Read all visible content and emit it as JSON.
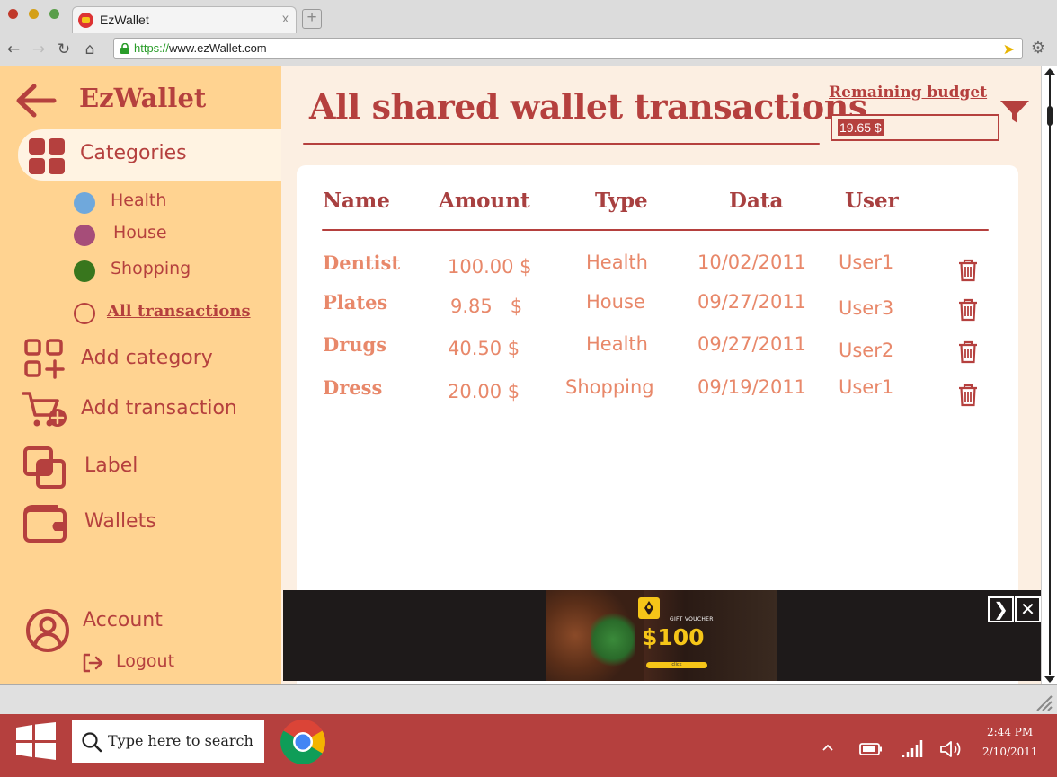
{
  "browser": {
    "tab_title": "EzWallet",
    "tab_close": "x",
    "url_protocol": "https://",
    "url_rest": "www.ezWallet.com"
  },
  "sidebar": {
    "brand": "EzWallet",
    "categories_label": "Categories",
    "category_items": [
      {
        "label": "Health",
        "color": "#6fa8dc"
      },
      {
        "label": "House",
        "color": "#a64d79"
      },
      {
        "label": "Shopping",
        "color": "#38761d"
      }
    ],
    "all_transactions_label": "All transactions",
    "add_category_label": "Add category",
    "add_transaction_label": "Add transaction",
    "label_label": "Label",
    "wallets_label": "Wallets",
    "account_label": "Account",
    "logout_label": "Logout"
  },
  "main": {
    "title": "All shared wallet transactions",
    "budget_label": "Remaining budget",
    "budget_value": "19.65 $",
    "columns": [
      "Name",
      "Amount",
      "Type",
      "Data",
      "User"
    ],
    "rows": [
      {
        "name": "Dentist",
        "amount": "100.00 $",
        "type": "Health",
        "date": "10/02/2011",
        "user": "User1"
      },
      {
        "name": "Plates",
        "amount": "9.85   $",
        "type": "House",
        "date": "09/27/2011",
        "user": "User3"
      },
      {
        "name": "Drugs",
        "amount": "40.50 $",
        "type": "Health",
        "date": "09/27/2011",
        "user": "User2"
      },
      {
        "name": "Dress",
        "amount": "20.00 $",
        "type": "Shopping",
        "date": "09/19/2011",
        "user": "User1"
      }
    ]
  },
  "ad": {
    "small_text": "GIFT VOUCHER",
    "price": "$100",
    "cta": "click"
  },
  "taskbar": {
    "search_placeholder": "Type here to search",
    "time": "2:44 PM",
    "date": "2/10/2011"
  },
  "colors": {
    "accent": "#b5403e",
    "sidebar_bg": "#ffd391",
    "row_text": "#e8886a"
  }
}
